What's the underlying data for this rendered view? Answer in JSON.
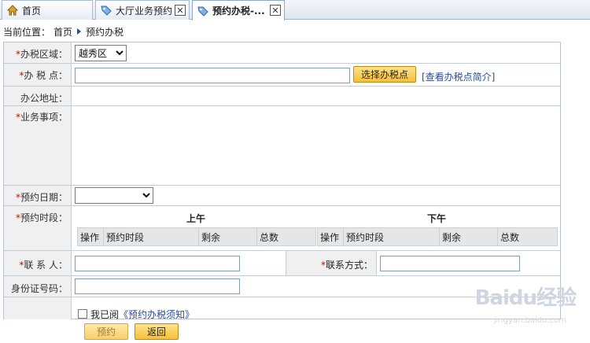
{
  "tabs": [
    {
      "label": "首页",
      "icon": "home-icon",
      "closable": false
    },
    {
      "label": "大厅业务预约",
      "icon": "tag-icon",
      "closable": true
    },
    {
      "label": "预约办税-...",
      "icon": "tag-icon",
      "closable": true
    }
  ],
  "breadcrumb": {
    "prefix": "当前位置：",
    "home": "首页",
    "current": "预约办税"
  },
  "form": {
    "district": {
      "label": "办税区域：",
      "value": "越秀区"
    },
    "office": {
      "label": "办 税 点：",
      "value": "",
      "select_button": "选择办税点",
      "info_link": "[查看办税点简介]"
    },
    "address": {
      "label": "办公地址："
    },
    "business": {
      "label": "业务事项："
    },
    "date": {
      "label": "预约日期：",
      "value": ""
    },
    "timeslot": {
      "label": "预约时段：",
      "morning": "上午",
      "afternoon": "下午",
      "columns": [
        "操作",
        "预约时段",
        "剩余",
        "总数"
      ]
    },
    "contact": {
      "label": "联 系 人：",
      "value": ""
    },
    "contact_method": {
      "label": "联系方式：",
      "value": ""
    },
    "id_number": {
      "label": "身份证号码：",
      "value": ""
    },
    "agree": {
      "prefix": "我已阅",
      "link": "《预约办税须知》",
      "checked": false
    }
  },
  "buttons": {
    "submit": "预约",
    "back": "返回"
  },
  "watermark": {
    "brand": "Baidu经验",
    "url": "jingyan.baidu.com"
  },
  "colors": {
    "required": "#d00000",
    "button": "#f6bf3a",
    "link": "#2a4a9a"
  }
}
